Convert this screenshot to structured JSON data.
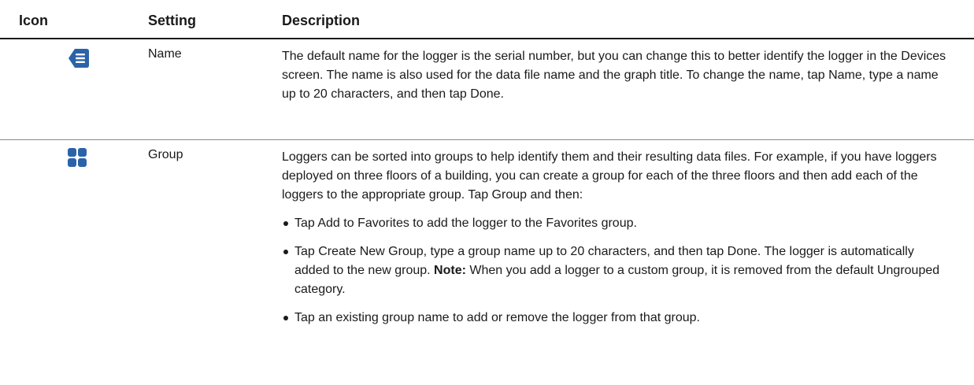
{
  "header": {
    "icon_col": "Icon",
    "setting_col": "Setting",
    "description_col": "Description"
  },
  "rows": [
    {
      "icon": "name-tag-icon",
      "setting": "Name",
      "description": "The default name for the logger is the serial number, but you can change this to better identify the logger in the Devices screen. The name is also used for the data file name and the graph title. To change the name, tap Name, type a name up to 20 characters, and then tap Done."
    },
    {
      "icon": "group-grid-icon",
      "setting": "Group",
      "description": "Loggers can be sorted into groups to help identify them and their resulting data files. For example, if you have loggers deployed on three floors of a building, you can create a group for each of the three floors and then add each of the loggers to the appropriate group. Tap Group and then:",
      "bullets": [
        {
          "text": "Tap Add to Favorites to add the logger to the Favorites group."
        },
        {
          "text": "Tap Create New Group, type a group name up to 20 characters, and then tap Done. The logger is automatically added to the new group. ",
          "note_label": "Note:",
          "note_text": " When you add a logger to a custom group, it is removed from the default Ungrouped category."
        },
        {
          "text": "Tap an existing group name to add or remove the logger from that group."
        }
      ]
    }
  ],
  "colors": {
    "icon_blue": "#2b63a8",
    "text": "#1a1a1a"
  }
}
